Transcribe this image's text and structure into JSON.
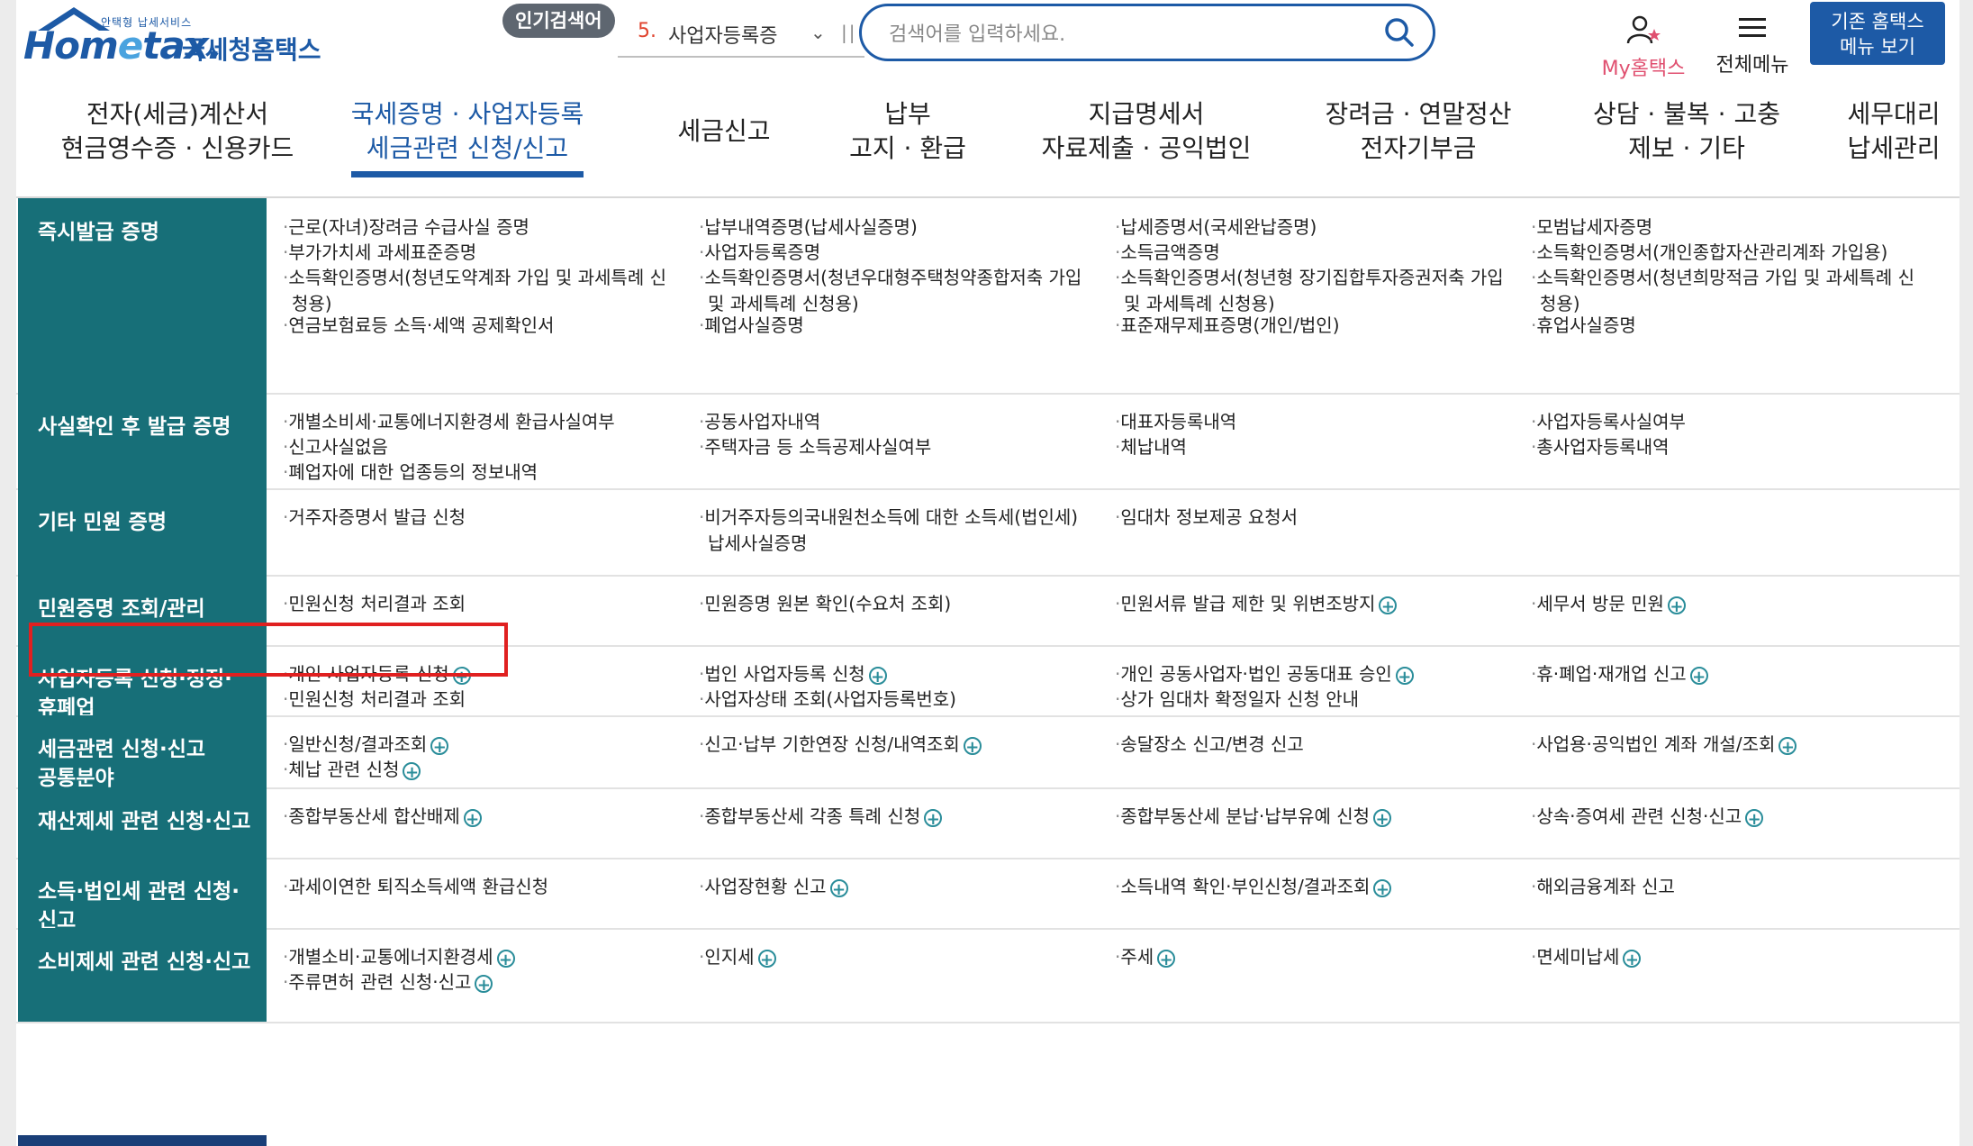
{
  "logo": {
    "small_text": "안택형 납세서비스",
    "brand": "Hometax",
    "name_ko": "국세청홈택스"
  },
  "popular": {
    "badge": "인기검색어",
    "rank": "5.",
    "term": "사업자등록증"
  },
  "search": {
    "placeholder": "검색어를 입력하세요."
  },
  "utility": {
    "my_hometax": "My홈택스",
    "all_menu": "전체메뉴",
    "legacy_line1": "기존 홈택스",
    "legacy_line2": "메뉴 보기"
  },
  "nav": [
    {
      "l1": "전자(세금)계산서",
      "l2": "현금영수증 · 신용카드"
    },
    {
      "l1": "국세증명 · 사업자등록",
      "l2": "세금관련 신청/신고"
    },
    {
      "l1": "세금신고",
      "l2": ""
    },
    {
      "l1": "납부",
      "l2": "고지 · 환급"
    },
    {
      "l1": "지급명세서",
      "l2": "자료제출 · 공익법인"
    },
    {
      "l1": "장려금 · 연말정산",
      "l2": "전자기부금"
    },
    {
      "l1": "상담 · 불복 · 고충",
      "l2": "제보 · 기타"
    },
    {
      "l1": "세무대리",
      "l2": "납세관리"
    }
  ],
  "sections": [
    {
      "title": "즉시발급 증명",
      "items": [
        {
          "t": "근로(자녀)장려금 수급사실 증명"
        },
        {
          "t": "납부내역증명(납세사실증명)"
        },
        {
          "t": "납세증명서(국세완납증명)"
        },
        {
          "t": "모범납세자증명"
        },
        {
          "t": "부가가치세 과세표준증명"
        },
        {
          "t": "사업자등록증명"
        },
        {
          "t": "소득금액증명"
        },
        {
          "t": "소득확인증명서(개인종합자산관리계좌 가입용)"
        },
        {
          "t": "소득확인증명서(청년도약계좌 가입 및 과세특례 신",
          "t2": "청용)"
        },
        {
          "t": "소득확인증명서(청년우대형주택청약종합저축 가입",
          "t2": "및 과세특례 신청용)"
        },
        {
          "t": "소득확인증명서(청년형 장기집합투자증권저축 가입",
          "t2": "및 과세특례 신청용)"
        },
        {
          "t": "소득확인증명서(청년희망적금 가입 및 과세특례 신",
          "t2": "청용)"
        },
        {
          "t": "연금보험료등 소득·세액 공제확인서"
        },
        {
          "t": "폐업사실증명"
        },
        {
          "t": "표준재무제표증명(개인/법인)"
        },
        {
          "t": "휴업사실증명"
        }
      ]
    },
    {
      "title": "사실확인 후 발급 증명",
      "items": [
        {
          "t": "개별소비세·교통에너지환경세 환급사실여부"
        },
        {
          "t": "공동사업자내역"
        },
        {
          "t": "대표자등록내역"
        },
        {
          "t": "사업자등록사실여부"
        },
        {
          "t": "신고사실없음"
        },
        {
          "t": "주택자금 등 소득공제사실여부"
        },
        {
          "t": "체납내역"
        },
        {
          "t": "총사업자등록내역"
        },
        {
          "t": "폐업자에 대한 업종등의 정보내역"
        }
      ]
    },
    {
      "title": "기타 민원 증명",
      "items": [
        {
          "t": "거주자증명서 발급 신청"
        },
        {
          "t": "비거주자등의국내원천소득에 대한 소득세(법인세)",
          "t2": "납세사실증명"
        },
        {
          "t": "임대차 정보제공 요청서"
        }
      ]
    },
    {
      "title": "민원증명 조회/관리",
      "items": [
        {
          "t": "민원신청 처리결과 조회"
        },
        {
          "t": "민원증명 원본 확인(수요처 조회)"
        },
        {
          "t": "민원서류 발급 제한 및 위변조방지",
          "plus": true
        },
        {
          "t": "세무서 방문 민원",
          "plus": true
        }
      ]
    },
    {
      "title": "사업자등록 신청·정정·",
      "title2": "휴폐업",
      "items": [
        {
          "t": "개인 사업자등록 신청",
          "plus": true
        },
        {
          "t": "법인 사업자등록 신청",
          "plus": true
        },
        {
          "t": "개인 공동사업자·법인 공동대표 승인",
          "plus": true
        },
        {
          "t": "휴·폐업·재개업 신고",
          "plus": true
        },
        {
          "t": "민원신청 처리결과 조회"
        },
        {
          "t": "사업자상태 조회(사업자등록번호)"
        },
        {
          "t": "상가 임대차 확정일자 신청 안내"
        }
      ]
    },
    {
      "title": "세금관련 신청·신고",
      "title2": "공통분야",
      "items": [
        {
          "t": "일반신청/결과조회",
          "plus": true
        },
        {
          "t": "신고·납부 기한연장 신청/내역조회",
          "plus": true
        },
        {
          "t": "송달장소 신고/변경 신고"
        },
        {
          "t": "사업용·공익법인 계좌 개설/조회",
          "plus": true
        },
        {
          "t": "체납 관련 신청",
          "plus": true
        }
      ]
    },
    {
      "title": "재산제세 관련 신청·신고",
      "items": [
        {
          "t": "종합부동산세 합산배제",
          "plus": true
        },
        {
          "t": "종합부동산세 각종 특례 신청",
          "plus": true
        },
        {
          "t": "종합부동산세 분납·납부유예 신청",
          "plus": true
        },
        {
          "t": "상속·증여세 관련 신청·신고",
          "plus": true
        }
      ]
    },
    {
      "title": "소득·법인세 관련 신청·",
      "title2": "신고",
      "items": [
        {
          "t": "과세이연한 퇴직소득세액 환급신청"
        },
        {
          "t": "사업장현황 신고",
          "plus": true
        },
        {
          "t": "소득내역 확인·부인신청/결과조회",
          "plus": true
        },
        {
          "t": "해외금융계좌 신고"
        }
      ]
    },
    {
      "title": "소비제세 관련 신청·신고",
      "items": [
        {
          "t": "개별소비·교통에너지환경세",
          "plus": true
        },
        {
          "t": "인지세",
          "plus": true
        },
        {
          "t": "주세",
          "plus": true
        },
        {
          "t": "면세미납세",
          "plus": true
        },
        {
          "t": "주류면허 관련 신청·신고",
          "plus": true
        }
      ]
    }
  ],
  "colors": {
    "brand": "#1d5aa6",
    "category_bg": "#176f78",
    "highlight": "#e02020"
  }
}
